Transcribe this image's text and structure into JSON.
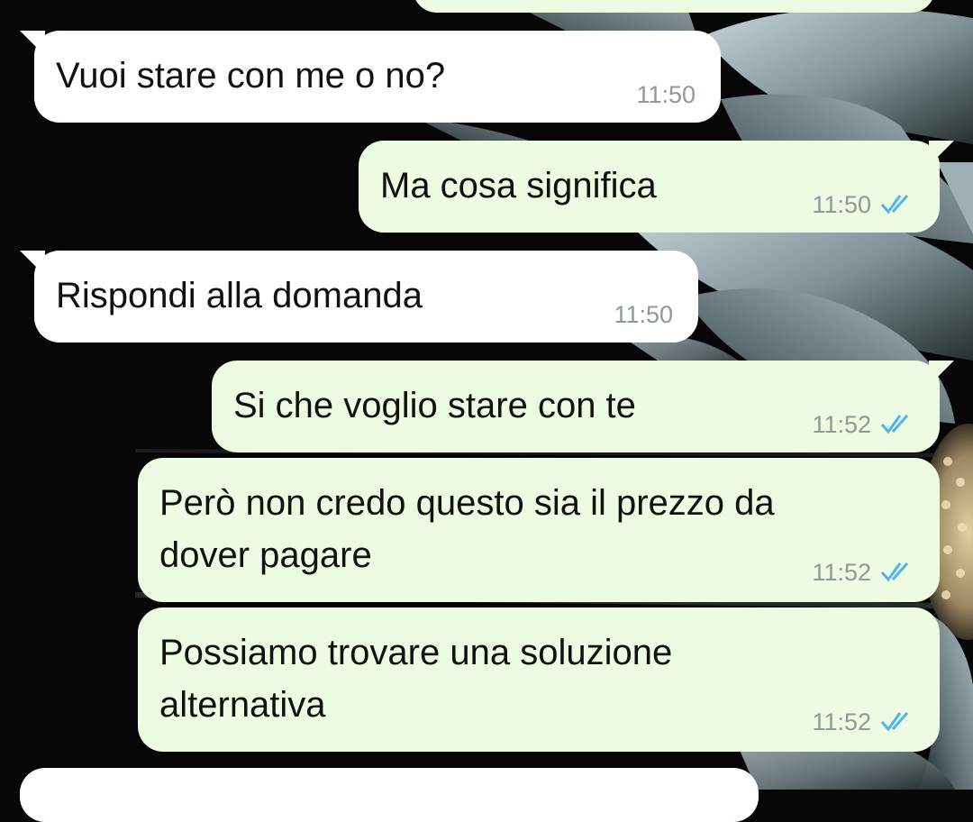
{
  "colors": {
    "incoming_bubble": "#ffffff",
    "outgoing_bubble": "#ecfbe1",
    "text": "#111111",
    "timestamp": "#8f9a94",
    "read_check": "#4fb4f0"
  },
  "messages": [
    {
      "direction": "incoming",
      "text": "Vuoi stare con me o no?",
      "time": "11:50"
    },
    {
      "direction": "outgoing",
      "text": "Ma cosa significa",
      "time": "11:50",
      "status_icon": "double-check-read-icon"
    },
    {
      "direction": "incoming",
      "text": "Rispondi alla domanda",
      "time": "11:50"
    },
    {
      "direction": "outgoing",
      "text": "Si che voglio stare con te",
      "time": "11:52",
      "status_icon": "double-check-read-icon"
    },
    {
      "direction": "outgoing",
      "lines": [
        "Però non credo questo sia il prezzo da",
        "dover pagare"
      ],
      "time": "11:52",
      "status_icon": "double-check-read-icon"
    },
    {
      "direction": "outgoing",
      "lines": [
        "Possiamo trovare una soluzione",
        "alternativa"
      ],
      "time": "11:52",
      "status_icon": "double-check-read-icon"
    }
  ]
}
